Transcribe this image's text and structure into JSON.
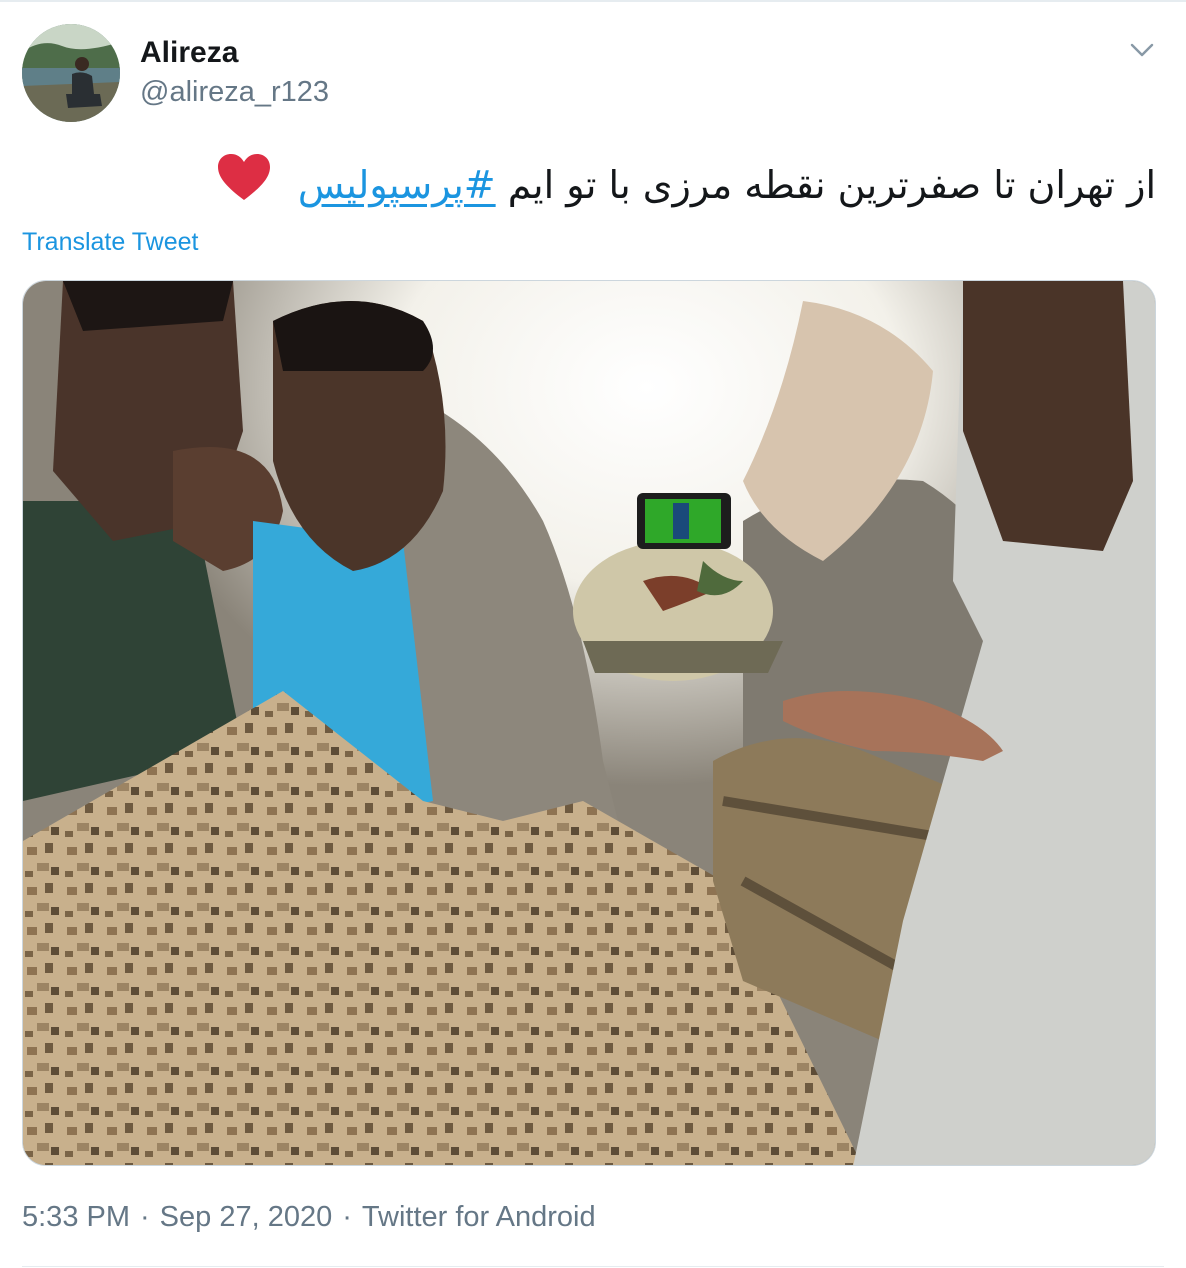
{
  "tweet": {
    "author": {
      "display_name": "Alireza",
      "handle": "@alireza_r123"
    },
    "text_main": "از تهران تا صفرترین نقطه مرزی با تو ایم",
    "hashtag": "#پرسپولیس",
    "emoji": "heart-icon",
    "translate_label": "Translate Tweet",
    "time": "5:33 PM",
    "date": "Sep 27, 2020",
    "separator": "·",
    "source": "Twitter for Android"
  },
  "colors": {
    "link": "#1b95e0",
    "muted": "#657786",
    "heart": "#e0245e"
  }
}
